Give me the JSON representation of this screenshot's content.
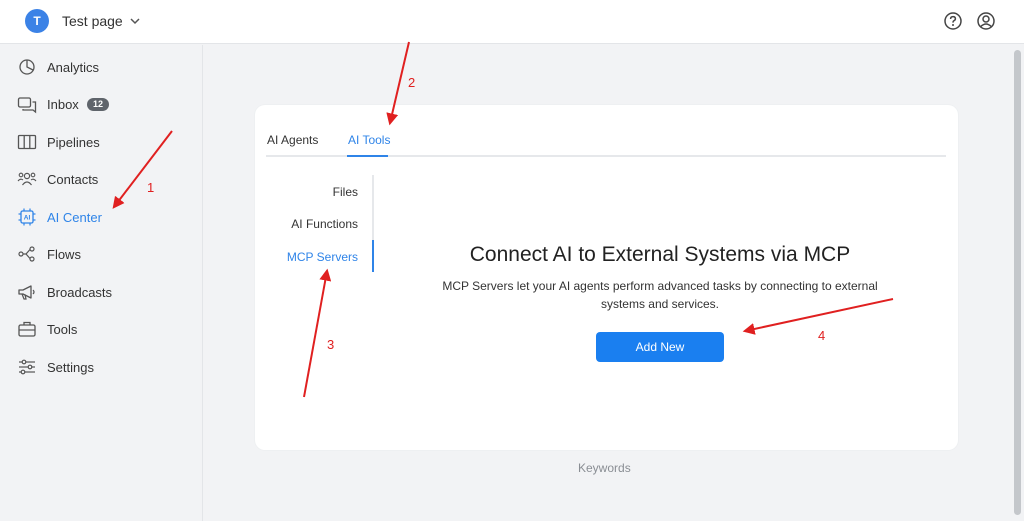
{
  "header": {
    "avatar_letter": "T",
    "page_name": "Test page"
  },
  "sidebar": {
    "items": [
      {
        "label": "Analytics",
        "icon": "analytics-icon"
      },
      {
        "label": "Inbox",
        "icon": "inbox-icon",
        "badge": "12"
      },
      {
        "label": "Pipelines",
        "icon": "pipelines-icon"
      },
      {
        "label": "Contacts",
        "icon": "contacts-icon"
      },
      {
        "label": "AI Center",
        "icon": "ai-chip-icon",
        "active": true
      },
      {
        "label": "Flows",
        "icon": "flows-icon"
      },
      {
        "label": "Broadcasts",
        "icon": "megaphone-icon"
      },
      {
        "label": "Tools",
        "icon": "toolbox-icon"
      },
      {
        "label": "Settings",
        "icon": "sliders-icon"
      }
    ]
  },
  "tabs": [
    {
      "label": "AI Agents"
    },
    {
      "label": "AI Tools",
      "active": true
    }
  ],
  "subnav": [
    {
      "label": "Files"
    },
    {
      "label": "AI Functions"
    },
    {
      "label": "MCP Servers",
      "active": true
    }
  ],
  "content": {
    "headline": "Connect AI to External Systems via MCP",
    "description": "MCP Servers let your AI agents perform advanced tasks by connecting to external systems and services.",
    "button_label": "Add New"
  },
  "footer": {
    "keywords": "Keywords"
  },
  "annotations": [
    "1",
    "2",
    "3",
    "4"
  ],
  "colors": {
    "accent": "#2f84e8",
    "button": "#1a7ff0",
    "annotation": "#e02020"
  }
}
